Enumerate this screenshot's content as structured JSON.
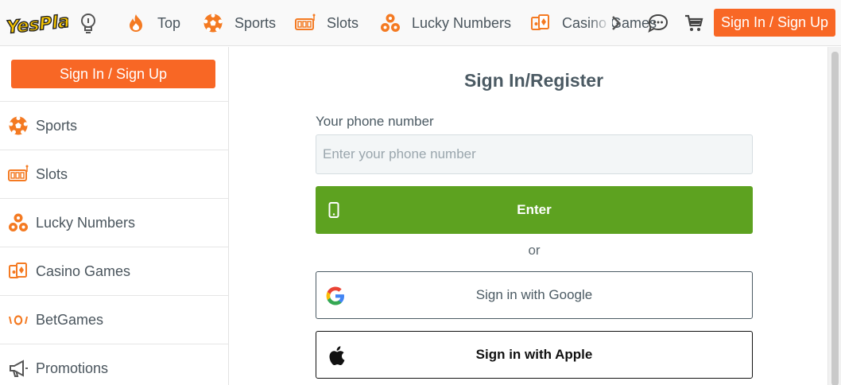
{
  "header": {
    "logo_text": "YesPlay",
    "nav": [
      {
        "label": "Top",
        "icon": "flame-icon"
      },
      {
        "label": "Sports",
        "icon": "soccer-ball-icon"
      },
      {
        "label": "Slots",
        "icon": "slot-reels-icon"
      },
      {
        "label": "Lucky Numbers",
        "icon": "lottery-balls-icon"
      },
      {
        "label": "Casino Games",
        "icon": "playing-cards-icon"
      }
    ],
    "sign_in_label": "Sign In / Sign Up"
  },
  "sidebar": {
    "sign_in_label": "Sign In / Sign Up",
    "items": [
      {
        "label": "Sports",
        "icon": "soccer-ball-icon"
      },
      {
        "label": "Slots",
        "icon": "slot-reels-icon"
      },
      {
        "label": "Lucky Numbers",
        "icon": "lottery-balls-icon"
      },
      {
        "label": "Casino Games",
        "icon": "playing-cards-icon"
      },
      {
        "label": "BetGames",
        "icon": "betgames-icon"
      },
      {
        "label": "Promotions",
        "icon": "megaphone-icon"
      }
    ]
  },
  "form": {
    "title": "Sign In/Register",
    "phone_label": "Your phone number",
    "phone_placeholder": "Enter your phone number",
    "phone_value": "",
    "enter_label": "Enter",
    "or_text": "or",
    "google_label": "Sign in with Google",
    "apple_label": "Sign in with Apple"
  },
  "colors": {
    "brand_orange": "#f86725",
    "enter_green": "#5da220",
    "text_dark": "#4b5a63"
  }
}
